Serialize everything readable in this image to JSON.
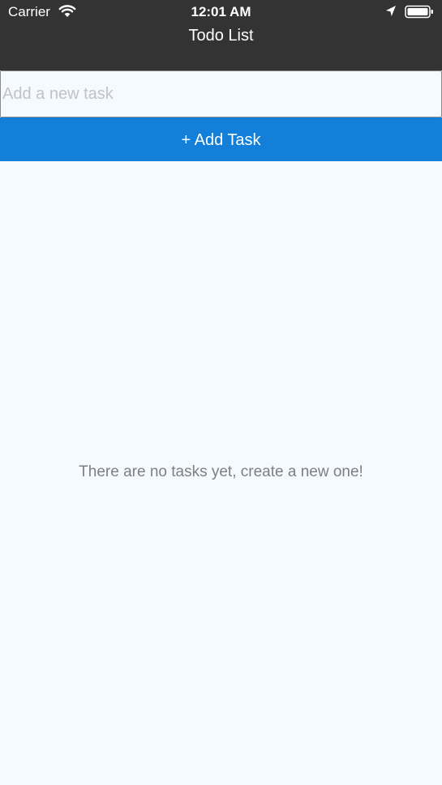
{
  "status_bar": {
    "carrier": "Carrier",
    "time": "12:01 AM",
    "icons": [
      "wifi-icon",
      "location-arrow-icon",
      "battery-icon"
    ]
  },
  "nav": {
    "title": "Todo List"
  },
  "new_task": {
    "placeholder": "Add a new task",
    "value": ""
  },
  "add_button": {
    "label": "+ Add Task"
  },
  "task_list": {
    "empty_message": "There are no tasks yet, create a new one!",
    "items": []
  },
  "colors": {
    "header_background": "#333333",
    "accent": "#137fd8",
    "page_background": "#f4faff",
    "empty_text": "#7f7f7f"
  }
}
